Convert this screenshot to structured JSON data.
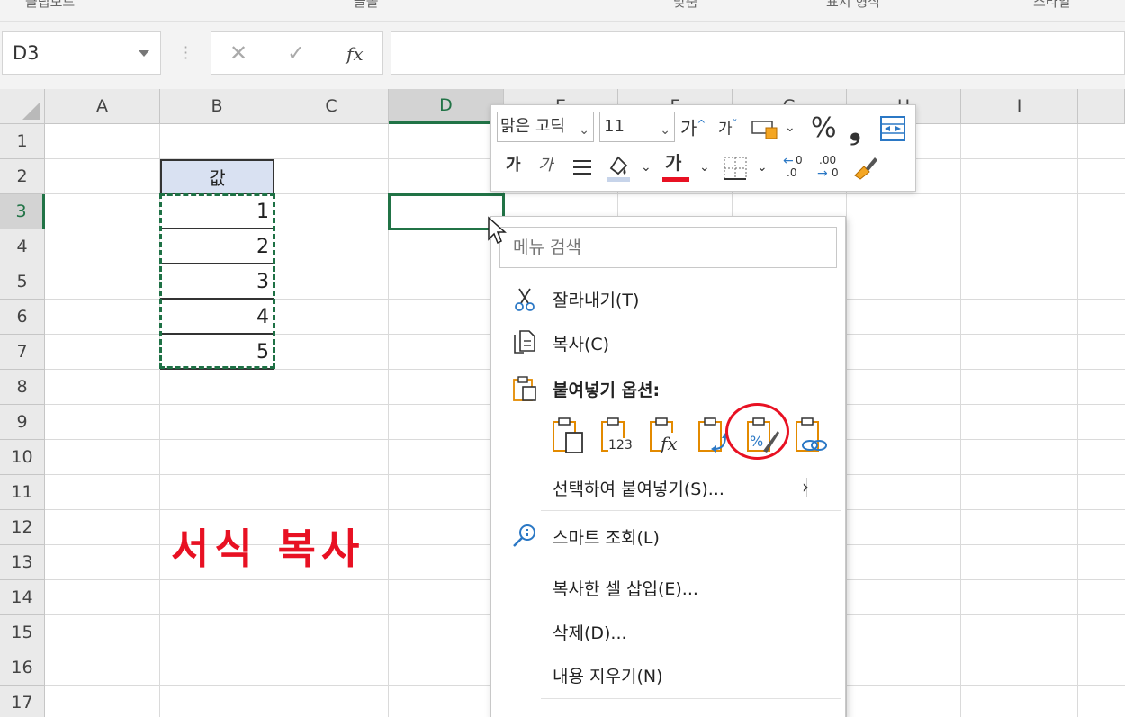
{
  "ribbon_strip": {
    "labels": [
      "클립보드",
      "글꼴",
      "맞춤",
      "표시 형식",
      "스타일"
    ]
  },
  "formula_bar": {
    "name_box": "D3",
    "cancel_symbol": "✕",
    "enter_symbol": "✓",
    "fx_symbol": "fx",
    "formula_value": ""
  },
  "sheet": {
    "columns": [
      "A",
      "B",
      "C",
      "D",
      "E",
      "F",
      "G",
      "H",
      "I"
    ],
    "selected_column": "D",
    "rows": [
      "1",
      "2",
      "3",
      "4",
      "5",
      "6",
      "7",
      "8",
      "9",
      "10",
      "11",
      "12",
      "13",
      "14",
      "15",
      "16",
      "17"
    ],
    "selected_row": "3",
    "selected_cell": "D3",
    "header_cell": "값",
    "values": [
      "1",
      "2",
      "3",
      "4",
      "5"
    ],
    "overlay_text": "서식 복사",
    "colors": {
      "accent_green": "#217346",
      "header_fill": "#d9e1f2",
      "annotation_red": "#e81123"
    }
  },
  "mini_toolbar": {
    "font_name": "맑은 고딕",
    "font_size": "11",
    "grow_font": "가",
    "shrink_font": "가",
    "percent": "%",
    "comma": "❟",
    "bold": "가",
    "italic": "가",
    "font_color_letter": "가",
    "increase_decimal": ".0",
    "decrease_decimal": ".00",
    "icons": [
      "format-cells-icon",
      "percent-icon",
      "comma-style-icon",
      "merge-center-icon",
      "align-icon",
      "fill-color-icon",
      "font-color-icon",
      "borders-icon",
      "increase-decimal-icon",
      "decrease-decimal-icon",
      "format-painter-icon"
    ]
  },
  "context_menu": {
    "search_placeholder": "메뉴 검색",
    "items": [
      {
        "label": "잘라내기(T)",
        "icon": "scissors-icon"
      },
      {
        "label": "복사(C)",
        "icon": "copy-icon"
      },
      {
        "label": "붙여넣기 옵션:",
        "icon": "paste-icon"
      },
      {
        "label": "선택하여 붙여넣기(S)...",
        "icon": ""
      },
      {
        "label": "스마트 조회(L)",
        "icon": "smart-lookup-icon"
      },
      {
        "label": "복사한 셀 삽입(E)...",
        "icon": ""
      },
      {
        "label": "삭제(D)...",
        "icon": ""
      },
      {
        "label": "내용 지우기(N)",
        "icon": ""
      }
    ],
    "paste_options": [
      "paste-icon",
      "paste-values-icon",
      "paste-formulas-icon",
      "paste-transpose-icon",
      "paste-formatting-icon",
      "paste-link-icon"
    ],
    "paste_option_labels": [
      "123",
      "fx",
      "%"
    ],
    "highlighted_paste_option": "paste-formatting-icon"
  }
}
